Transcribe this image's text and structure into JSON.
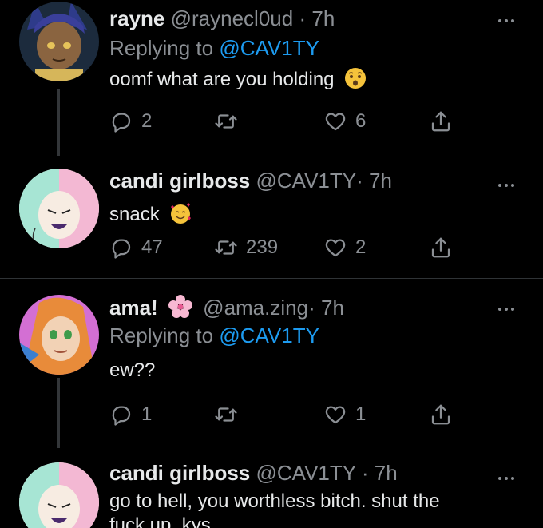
{
  "tweets": [
    {
      "name": "rayne",
      "handle": "@raynecl0ud",
      "dot": "·",
      "time": "7h",
      "reply_prefix": "Replying to ",
      "reply_mention": "@CAV1TY",
      "text": "oomf what are you holding",
      "text_emoji": "worried-face-emoji",
      "counts": {
        "reply": "2",
        "retweet": "",
        "like": "6"
      }
    },
    {
      "name": "candi girlboss",
      "handle": "@CAV1TY",
      "dot": "·",
      "time": "7h",
      "text": "snack",
      "text_emoji": "smiling-face-with-hearts-emoji",
      "counts": {
        "reply": "47",
        "retweet": "239",
        "like": "2"
      }
    },
    {
      "name": "ama!",
      "name_emoji": "cherry-blossom-emoji",
      "handle": "@ama.zing",
      "dot": "·",
      "time": "7h",
      "reply_prefix": "Replying to ",
      "reply_mention": "@CAV1TY",
      "text": "ew??",
      "counts": {
        "reply": "1",
        "retweet": "",
        "like": "1"
      }
    },
    {
      "name": "candi girlboss",
      "handle": "@CAV1TY",
      "dot": "·",
      "time": "7h",
      "text_line1": "go to hell, you worthless bitch. shut the",
      "text_line2": "fuck up. kys"
    }
  ],
  "colors": {
    "background": "#000000",
    "secondary_text": "#8b8f94",
    "mention": "#1d9bf0",
    "divider": "#2f3336"
  },
  "icons": [
    "reply-icon",
    "retweet-icon",
    "like-icon",
    "share-icon",
    "more-options-icon"
  ]
}
